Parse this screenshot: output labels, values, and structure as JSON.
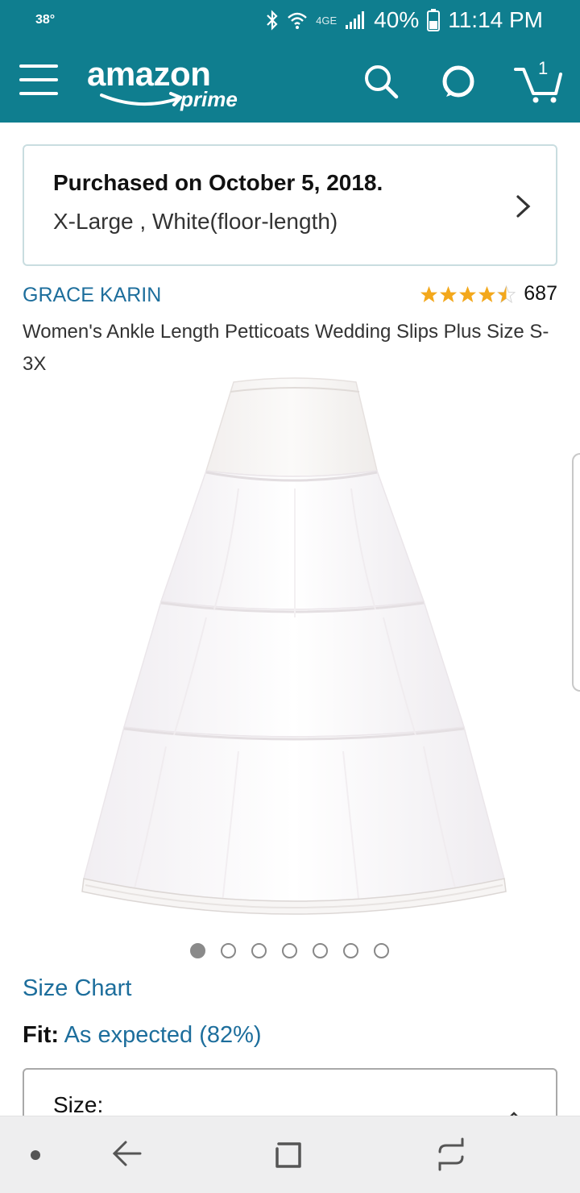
{
  "status_bar": {
    "temperature": "38°",
    "network": "4GE",
    "battery": "40%",
    "time": "11:14 PM"
  },
  "header": {
    "logo_main": "amazon",
    "logo_sub": "prime",
    "cart_count": "1",
    "icons": [
      "menu-icon",
      "search-icon",
      "alexa-icon",
      "cart-icon"
    ]
  },
  "purchase": {
    "title": "Purchased on October 5, 2018.",
    "variant": "X-Large , White(floor-length)"
  },
  "product": {
    "brand": "GRACE KARIN",
    "rating": 4.5,
    "rating_count": "687",
    "title": "Women's Ankle Length Petticoats Wedding Slips Plus Size S-3X",
    "image_count": 7,
    "active_image_index": 0
  },
  "size_chart": {
    "label": "Size Chart"
  },
  "fit": {
    "label": "Fit:",
    "value": "As expected (82%)"
  },
  "size_selector": {
    "label": "Size:"
  },
  "colors": {
    "brand_teal": "#0f7e8f",
    "link_blue": "#1d6e9c",
    "star_gold": "#f3a81c"
  }
}
